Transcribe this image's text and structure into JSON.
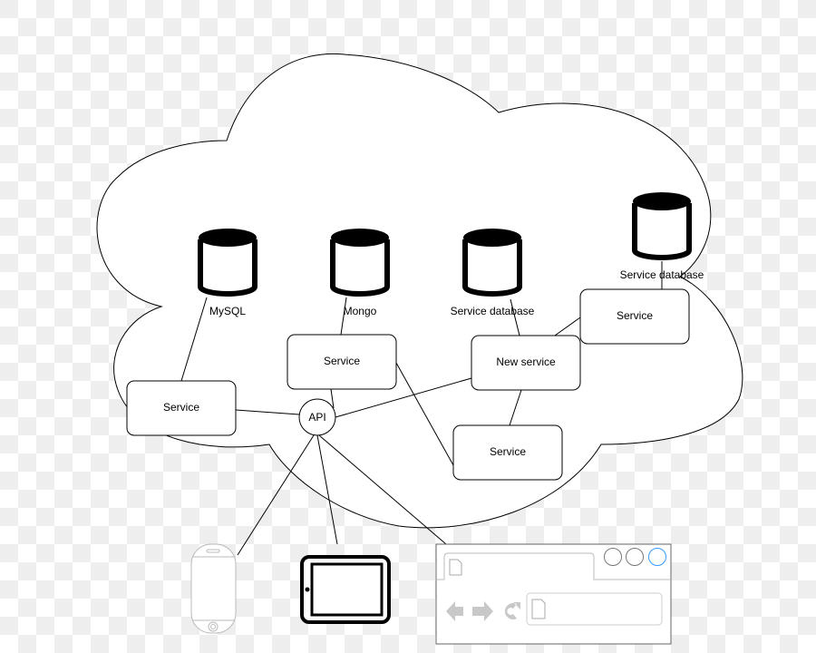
{
  "diagram": {
    "databases": [
      {
        "label": "MySQL"
      },
      {
        "label": "Mongo"
      },
      {
        "label": "Service database"
      },
      {
        "label": "Service database"
      }
    ],
    "services": [
      {
        "label": "Service"
      },
      {
        "label": "Service"
      },
      {
        "label": "New service"
      },
      {
        "label": "Service"
      },
      {
        "label": "Service"
      }
    ],
    "api": {
      "label": "API"
    },
    "clients": [
      "phone-icon",
      "tablet-icon",
      "browser-window-icon"
    ],
    "colors": {
      "stroke": "#000000",
      "browser_border": "#666666",
      "browser_icons": "#c8c8c8",
      "active_circle": "#3399ff"
    }
  }
}
